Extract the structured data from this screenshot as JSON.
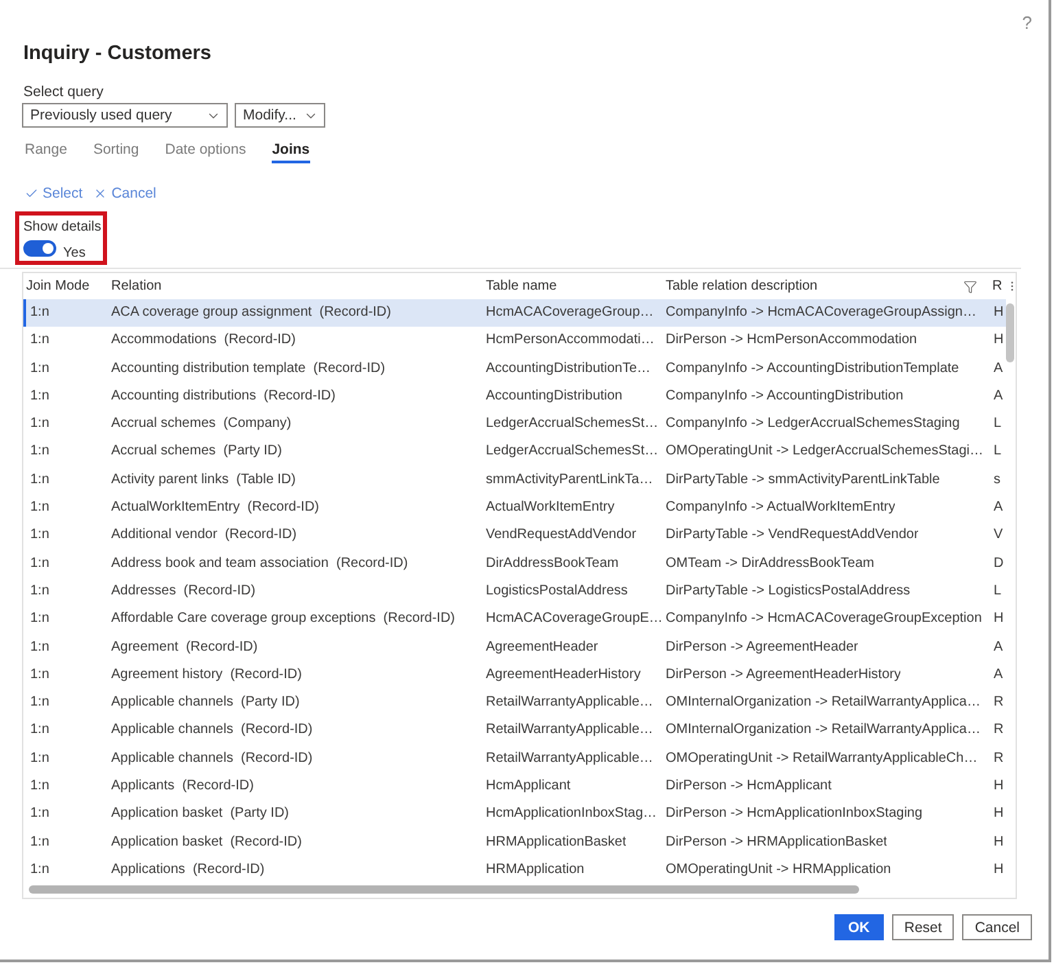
{
  "dialog": {
    "help_button": "?",
    "title": "Inquiry - Customers"
  },
  "query": {
    "label": "Select query",
    "value": "Previously used query",
    "modify_button": "Modify..."
  },
  "tabs": [
    {
      "label": "Range",
      "selected": false
    },
    {
      "label": "Sorting",
      "selected": false
    },
    {
      "label": "Date options",
      "selected": false
    },
    {
      "label": "Joins",
      "selected": true
    }
  ],
  "actions": [
    {
      "label": "Select",
      "kind": "check"
    },
    {
      "label": "Cancel",
      "kind": "cancel"
    }
  ],
  "show_details": {
    "label": "Show details",
    "on": true,
    "value": "Yes",
    "highlighted": true
  },
  "table": {
    "columns": [
      "Join Mode",
      "Relation",
      "Table name",
      "Table relation description",
      "R"
    ],
    "rows": [
      {
        "join_mode": "1:n",
        "relation": "ACA coverage group assignment  (Record-ID)",
        "table_name": "HcmACACoverageGroup…",
        "description": "CompanyInfo -> HcmACACoverageGroupAssign…",
        "column_5": "H",
        "selected": true
      },
      {
        "join_mode": "1:n",
        "relation": "Accommodations  (Record-ID)",
        "table_name": "HcmPersonAccommodati…",
        "description": "DirPerson -> HcmPersonAccommodation",
        "column_5": "H",
        "selected": false
      },
      {
        "join_mode": "1:n",
        "relation": "Accounting distribution template  (Record-ID)",
        "table_name": "AccountingDistributionTe…",
        "description": "CompanyInfo -> AccountingDistributionTemplate",
        "column_5": "A",
        "selected": false
      },
      {
        "join_mode": "1:n",
        "relation": "Accounting distributions  (Record-ID)",
        "table_name": "AccountingDistribution",
        "description": "CompanyInfo -> AccountingDistribution",
        "column_5": "A",
        "selected": false
      },
      {
        "join_mode": "1:n",
        "relation": "Accrual schemes  (Company)",
        "table_name": "LedgerAccrualSchemesSt…",
        "description": "CompanyInfo -> LedgerAccrualSchemesStaging",
        "column_5": "L",
        "selected": false
      },
      {
        "join_mode": "1:n",
        "relation": "Accrual schemes  (Party ID)",
        "table_name": "LedgerAccrualSchemesSt…",
        "description": "OMOperatingUnit -> LedgerAccrualSchemesStagi…",
        "column_5": "L",
        "selected": false
      },
      {
        "join_mode": "1:n",
        "relation": "Activity parent links  (Table ID)",
        "table_name": "smmActivityParentLinkTa…",
        "description": "DirPartyTable -> smmActivityParentLinkTable",
        "column_5": "s",
        "selected": false
      },
      {
        "join_mode": "1:n",
        "relation": "ActualWorkItemEntry  (Record-ID)",
        "table_name": "ActualWorkItemEntry",
        "description": "CompanyInfo -> ActualWorkItemEntry",
        "column_5": "A",
        "selected": false
      },
      {
        "join_mode": "1:n",
        "relation": "Additional vendor  (Record-ID)",
        "table_name": "VendRequestAddVendor",
        "description": "DirPartyTable -> VendRequestAddVendor",
        "column_5": "V",
        "selected": false
      },
      {
        "join_mode": "1:n",
        "relation": "Address book and team association  (Record-ID)",
        "table_name": "DirAddressBookTeam",
        "description": "OMTeam -> DirAddressBookTeam",
        "column_5": "D",
        "selected": false
      },
      {
        "join_mode": "1:n",
        "relation": "Addresses  (Record-ID)",
        "table_name": "LogisticsPostalAddress",
        "description": "DirPartyTable -> LogisticsPostalAddress",
        "column_5": "L",
        "selected": false
      },
      {
        "join_mode": "1:n",
        "relation": "Affordable Care coverage group exceptions  (Record-ID)",
        "table_name": "HcmACACoverageGroupE…",
        "description": "CompanyInfo -> HcmACACoverageGroupException",
        "column_5": "H",
        "selected": false
      },
      {
        "join_mode": "1:n",
        "relation": "Agreement  (Record-ID)",
        "table_name": "AgreementHeader",
        "description": "DirPerson -> AgreementHeader",
        "column_5": "A",
        "selected": false
      },
      {
        "join_mode": "1:n",
        "relation": "Agreement history  (Record-ID)",
        "table_name": "AgreementHeaderHistory",
        "description": "DirPerson -> AgreementHeaderHistory",
        "column_5": "A",
        "selected": false
      },
      {
        "join_mode": "1:n",
        "relation": "Applicable channels  (Party ID)",
        "table_name": "RetailWarrantyApplicable…",
        "description": "OMInternalOrganization -> RetailWarrantyApplica…",
        "column_5": "R",
        "selected": false
      },
      {
        "join_mode": "1:n",
        "relation": "Applicable channels  (Record-ID)",
        "table_name": "RetailWarrantyApplicable…",
        "description": "OMInternalOrganization -> RetailWarrantyApplica…",
        "column_5": "R",
        "selected": false
      },
      {
        "join_mode": "1:n",
        "relation": "Applicable channels  (Record-ID)",
        "table_name": "RetailWarrantyApplicable…",
        "description": "OMOperatingUnit -> RetailWarrantyApplicableCh…",
        "column_5": "R",
        "selected": false
      },
      {
        "join_mode": "1:n",
        "relation": "Applicants  (Record-ID)",
        "table_name": "HcmApplicant",
        "description": "DirPerson -> HcmApplicant",
        "column_5": "H",
        "selected": false
      },
      {
        "join_mode": "1:n",
        "relation": "Application basket  (Party ID)",
        "table_name": "HcmApplicationInboxStag…",
        "description": "DirPerson -> HcmApplicationInboxStaging",
        "column_5": "H",
        "selected": false
      },
      {
        "join_mode": "1:n",
        "relation": "Application basket  (Record-ID)",
        "table_name": "HRMApplicationBasket",
        "description": "DirPerson -> HRMApplicationBasket",
        "column_5": "H",
        "selected": false
      },
      {
        "join_mode": "1:n",
        "relation": "Applications  (Record-ID)",
        "table_name": "HRMApplication",
        "description": "OMOperatingUnit -> HRMApplication",
        "column_5": "H",
        "selected": false
      }
    ]
  },
  "buttons": [
    {
      "label": "OK",
      "kind": "primary"
    },
    {
      "label": "Reset",
      "kind": "default"
    },
    {
      "label": "Cancel",
      "kind": "default"
    }
  ]
}
